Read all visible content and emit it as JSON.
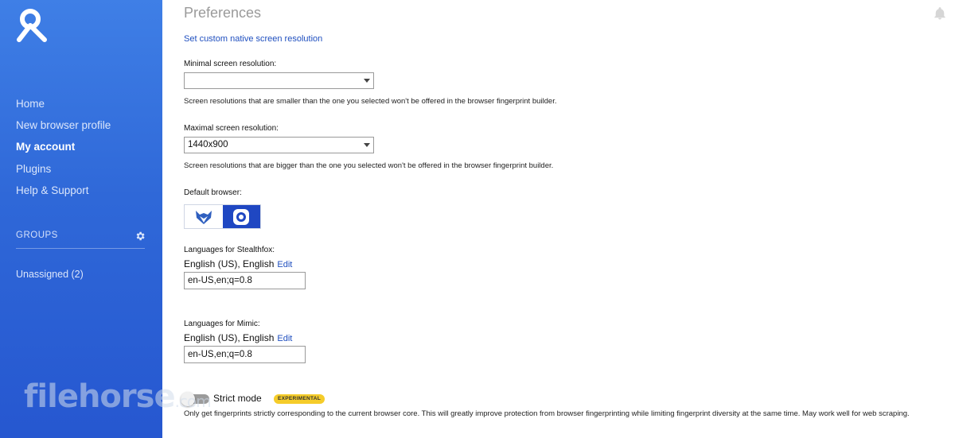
{
  "sidebar": {
    "nav": [
      {
        "label": "Home"
      },
      {
        "label": "New browser profile"
      },
      {
        "label": "My account"
      },
      {
        "label": "Plugins"
      },
      {
        "label": "Help & Support"
      }
    ],
    "groups_label": "GROUPS",
    "group_items": [
      {
        "label": "Unassigned (2)"
      }
    ]
  },
  "main": {
    "title": "Preferences",
    "custom_resolution_link": "Set custom native screen resolution",
    "min_resolution": {
      "label": "Minimal screen resolution:",
      "value": "",
      "hint": "Screen resolutions that are smaller than the one you selected won't be offered in the browser fingerprint builder."
    },
    "max_resolution": {
      "label": "Maximal screen resolution:",
      "value": "1440x900",
      "hint": "Screen resolutions that are bigger than the one you selected won't be offered in the browser fingerprint builder."
    },
    "default_browser": {
      "label": "Default browser:",
      "options": [
        "stealthfox-fox-icon",
        "mimic-circle-icon"
      ],
      "selected": "mimic-circle-icon"
    },
    "stealthfox_lang": {
      "label": "Languages for Stealthfox:",
      "display": "English (US), English",
      "edit": "Edit",
      "value": "en-US,en;q=0.8"
    },
    "mimic_lang": {
      "label": "Languages for Mimic:",
      "display": "English (US), English",
      "edit": "Edit",
      "value": "en-US,en;q=0.8"
    },
    "strict_mode": {
      "label": "Strict mode",
      "badge": "EXPERIMENTAL",
      "enabled": false,
      "description": "Only get fingerprints strictly corresponding to the current browser core. This will greatly improve protection from browser fingerprinting while limiting fingerprint diversity at the same time. May work well for web scraping."
    }
  },
  "watermark": {
    "text": "filehorse",
    "suffix": ".com"
  },
  "colors": {
    "sidebar": "#2f68d8",
    "link": "#1f4fbf",
    "badge": "#f5cc2a",
    "selected_browser": "#1f47c2"
  }
}
